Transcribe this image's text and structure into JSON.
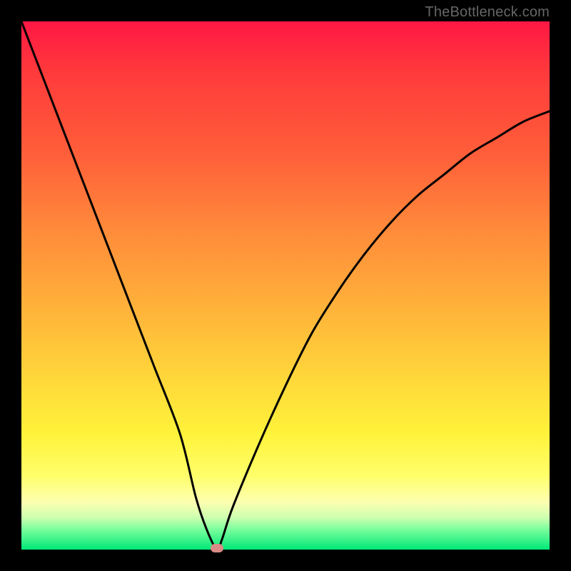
{
  "watermark": "TheBottleneck.com",
  "colors": {
    "page_bg": "#000000",
    "curve": "#000000",
    "marker": "#d98a86"
  },
  "chart_data": {
    "type": "line",
    "title": "",
    "xlabel": "",
    "ylabel": "",
    "xlim": [
      0,
      100
    ],
    "ylim": [
      0,
      100
    ],
    "background_gradient": {
      "top": "#ff1744",
      "mid": "#ffd83a",
      "bottom": "#00e878",
      "meaning": "red=high bottleneck, green=low bottleneck"
    },
    "series": [
      {
        "name": "bottleneck-curve",
        "x": [
          0,
          5,
          10,
          15,
          20,
          25,
          30,
          33,
          35,
          37,
          38,
          40,
          45,
          50,
          55,
          60,
          65,
          70,
          75,
          80,
          85,
          90,
          95,
          100
        ],
        "values": [
          100,
          87,
          74,
          61,
          48,
          35,
          22,
          10,
          4,
          0,
          2,
          8,
          20,
          31,
          41,
          49,
          56,
          62,
          67,
          71,
          75,
          78,
          81,
          83
        ]
      }
    ],
    "marker": {
      "x": 37,
      "y": 0
    },
    "notes": "Curve drops steeply from top-left to a minimum near x≈37 at y≈0, then rises with diminishing slope toward the right edge reaching roughly 83% of height. Values estimated from pixel positions; axes are unlabeled in the source image."
  }
}
